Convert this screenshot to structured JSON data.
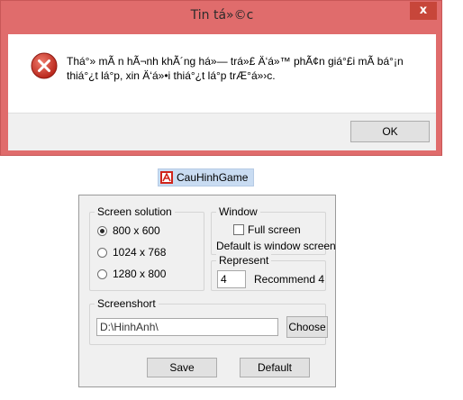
{
  "error_dialog": {
    "title": "Tin tá»©c",
    "close_label": "x",
    "message_line1": "Thá°» mÃ n hÃ¬nh khÃ´ng há»— trá»£ Ä‘á»™ phÃ¢n giá°£i mÃ  bá°¡n",
    "message_line2": "thiá°¿t lá°­p, xin Ä‘á»•i thiá°¿t lá°­p trÆ°á»›c.",
    "ok_label": "OK",
    "icon": "error-icon"
  },
  "app": {
    "title": "CauHinhGame",
    "logo_icon": "cauhinhgame-logo-icon",
    "screen_solution": {
      "label": "Screen solution",
      "options": [
        {
          "label": "800 x 600",
          "checked": true
        },
        {
          "label": "1024 x 768",
          "checked": false
        },
        {
          "label": "1280 x 800",
          "checked": false
        }
      ]
    },
    "window": {
      "label": "Window",
      "full_screen_label": "Full screen",
      "full_screen_checked": false,
      "default_note": "Default is window screen"
    },
    "represent": {
      "label": "Represent",
      "value": "4",
      "recommend": "Recommend 4"
    },
    "screenshot": {
      "label": "Screenshort",
      "path": "D:\\HinhAnh\\",
      "choose_label": "Choose"
    },
    "save_label": "Save",
    "default_label": "Default"
  }
}
